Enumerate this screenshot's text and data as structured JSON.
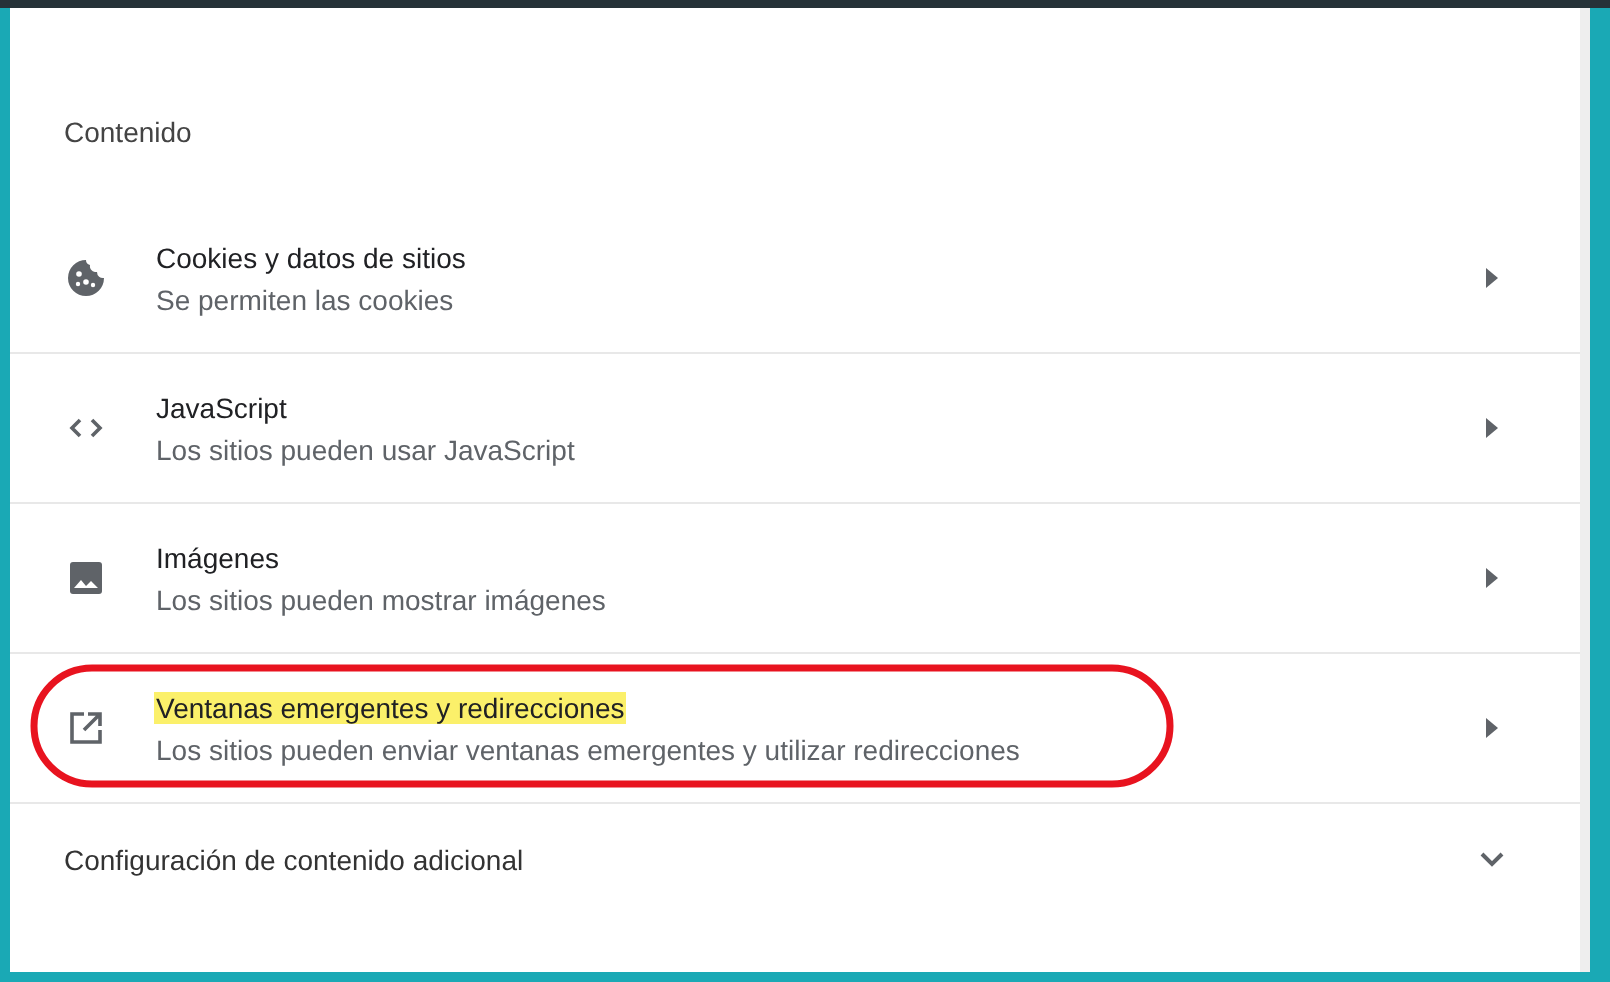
{
  "section": {
    "heading": "Contenido",
    "items": [
      {
        "title": "Cookies y datos de sitios",
        "subtitle": "Se permiten las cookies",
        "highlighted": false,
        "circled": false
      },
      {
        "title": "JavaScript",
        "subtitle": "Los sitios pueden usar JavaScript",
        "highlighted": false,
        "circled": false
      },
      {
        "title": "Imágenes",
        "subtitle": "Los sitios pueden mostrar imágenes",
        "highlighted": false,
        "circled": false
      },
      {
        "title": "Ventanas emergentes y redirecciones",
        "subtitle": "Los sitios pueden enviar ventanas emergentes y utilizar redirecciones",
        "highlighted": true,
        "circled": true
      }
    ],
    "more": {
      "label": "Configuración de contenido adicional",
      "expanded": false
    }
  }
}
